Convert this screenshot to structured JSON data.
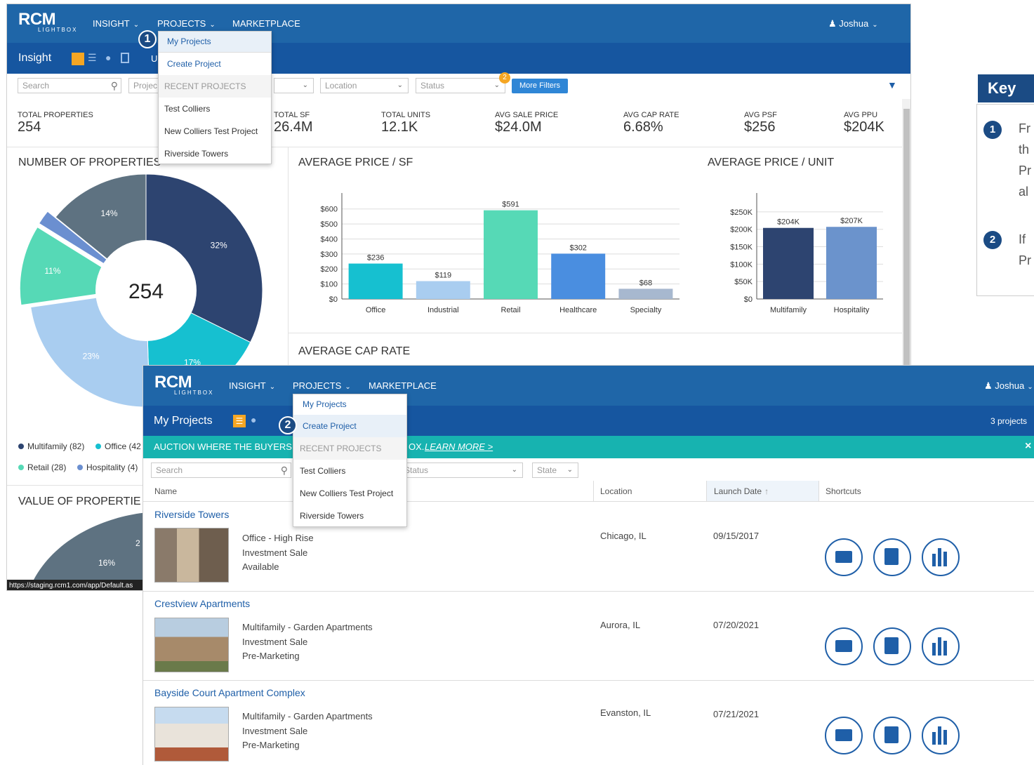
{
  "app": {
    "logo": "RCM",
    "logo_sub": "LIGHTBOX",
    "nav": {
      "insight": "INSIGHT",
      "projects": "PROJECTS",
      "marketplace": "MARKETPLACE"
    },
    "user": "Joshua",
    "projects_menu": {
      "my_projects": "My Projects",
      "create_project": "Create Project",
      "recent_header": "RECENT PROJECTS",
      "recent": [
        "Test Colliers",
        "New Colliers Test Project",
        "Riverside Towers"
      ]
    }
  },
  "callouts": {
    "one": "1",
    "two": "2"
  },
  "insight": {
    "title": "Insight",
    "tab_u": "U",
    "filters": {
      "search": "Search",
      "project": "Projec",
      "location": "Location",
      "status": "Status",
      "status_badge": "2",
      "more_filters": "More Filters"
    },
    "stats": [
      {
        "label": "TOTAL PROPERTIES",
        "value": "254"
      },
      {
        "label": "TOTAL SF",
        "value": "26.4M"
      },
      {
        "label": "TOTAL UNITS",
        "value": "12.1K"
      },
      {
        "label": "AVG SALE PRICE",
        "value": "$24.0M"
      },
      {
        "label": "AVG CAP RATE",
        "value": "6.68%"
      },
      {
        "label": "AVG PSF",
        "value": "$256"
      },
      {
        "label": "AVG PPU",
        "value": "$204K"
      }
    ],
    "number_title": "NUMBER OF PROPERTIES",
    "value_title": "VALUE OF PROPERTIE",
    "cap_rate_title": "AVERAGE CAP RATE",
    "legend": [
      "Multifamily (82)",
      "Office (42",
      "Retail (28)",
      "Hospitality (4)"
    ],
    "status_url": "https://staging.rcm1.com/app/Default.as"
  },
  "chart_data": [
    {
      "type": "pie",
      "title": "NUMBER OF PROPERTIES",
      "center_label": "254",
      "categories": [
        "Multifamily",
        "Office",
        "Healthcare",
        "Retail",
        "Hospitality",
        "Specialty"
      ],
      "values": [
        32,
        17,
        23,
        11,
        2,
        14
      ],
      "labels": [
        "32%",
        "17%",
        "23%",
        "11%",
        "",
        "14%"
      ],
      "colors": [
        "#2d4470",
        "#16c0d0",
        "#a9cdf0",
        "#56d9b6",
        "#6b8fd0",
        "#5e7281"
      ],
      "legend": "bottom"
    },
    {
      "type": "bar",
      "title": "AVERAGE PRICE / SF",
      "categories": [
        "Office",
        "Industrial",
        "Retail",
        "Healthcare",
        "Specialty"
      ],
      "values": [
        236,
        119,
        591,
        302,
        68
      ],
      "data_labels": [
        "$236",
        "$119",
        "$591",
        "$302",
        "$68"
      ],
      "colors": [
        "#16c0d0",
        "#a9cdf0",
        "#56d9b6",
        "#4a8ee0",
        "#a7b8cf"
      ],
      "yticks": [
        "$0",
        "$100",
        "$200",
        "$300",
        "$400",
        "$500",
        "$600"
      ],
      "ylim": [
        0,
        650
      ],
      "grid": true
    },
    {
      "type": "bar",
      "title": "AVERAGE PRICE / UNIT",
      "categories": [
        "Multifamily",
        "Hospitality"
      ],
      "values": [
        204,
        207
      ],
      "data_labels": [
        "$204K",
        "$207K"
      ],
      "colors": [
        "#2d4470",
        "#6b93cc"
      ],
      "yticks": [
        "$0",
        "$50K",
        "$100K",
        "$150K",
        "$200K",
        "$250K"
      ],
      "ylim": [
        0,
        280
      ],
      "grid": true
    },
    {
      "type": "pie",
      "title": "VALUE OF PROPERTIE",
      "labels": [
        "16%",
        "2"
      ]
    }
  ],
  "projects": {
    "title": "My Projects",
    "count": "3 projects",
    "banner_prefix": "AUCTION WHERE THE BUYERS",
    "banner_suffix": "OX.",
    "banner_link": "LEARN MORE >",
    "banner_close": "×",
    "filters": {
      "search": "Search",
      "status": "Status",
      "state": "State"
    },
    "columns": {
      "name": "Name",
      "location": "Location",
      "launch": "Launch Date",
      "shortcuts": "Shortcuts"
    },
    "rows": [
      {
        "name": "Riverside Towers",
        "type": "Office - High Rise",
        "sale": "Investment Sale",
        "status": "Available",
        "location": "Chicago, IL",
        "date": "09/15/2017"
      },
      {
        "name": "Crestview Apartments",
        "type": "Multifamily - Garden Apartments",
        "sale": "Investment Sale",
        "status": "Pre-Marketing",
        "location": "Aurora, IL",
        "date": "07/20/2021"
      },
      {
        "name": "Bayside Court Apartment Complex",
        "type": "Multifamily - Garden Apartments",
        "sale": "Investment Sale",
        "status": "Pre-Marketing",
        "location": "Evanston, IL",
        "date": "07/21/2021"
      }
    ]
  },
  "key": {
    "title": "Key",
    "item1_num": "1",
    "item1_lines": [
      "Fr",
      "th",
      "Pr",
      "al"
    ],
    "item2_num": "2",
    "item2_lines": [
      "If",
      "Pr"
    ]
  }
}
